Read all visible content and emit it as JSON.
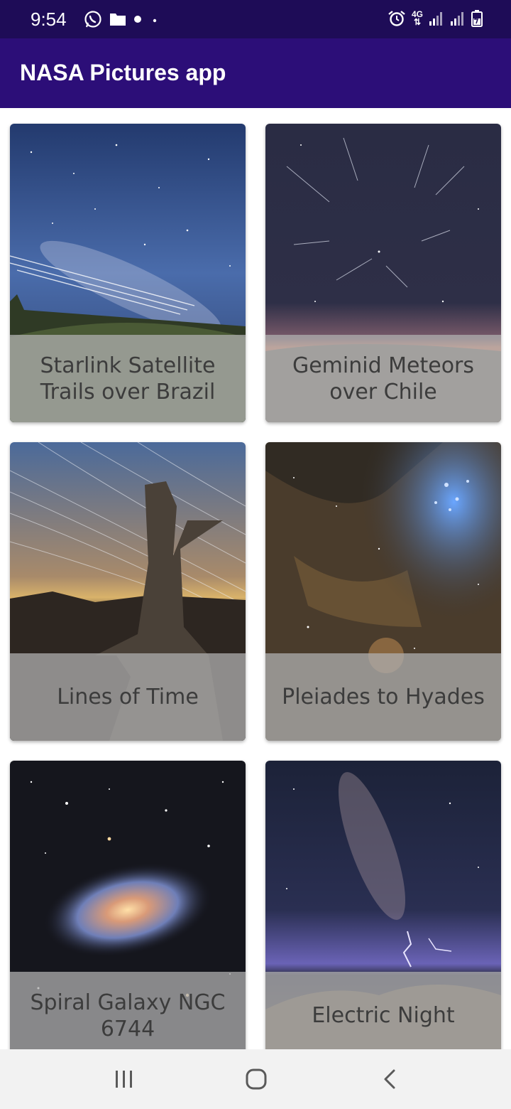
{
  "status_bar": {
    "time": "9:54",
    "network": "4G",
    "left_icons": [
      "whatsapp-icon",
      "folder-icon",
      "dot-icon"
    ],
    "right_icons": [
      "alarm-icon",
      "network-4g-icon",
      "signal-icon",
      "signal-icon",
      "battery-icon"
    ]
  },
  "app_bar": {
    "title": "NASA Pictures app",
    "color": "#2c0e78"
  },
  "pictures": [
    {
      "title": "Starlink Satellite Trails over Brazil"
    },
    {
      "title": "Geminid Meteors over Chile"
    },
    {
      "title": "Lines of Time"
    },
    {
      "title": "Pleiades to Hyades"
    },
    {
      "title": "Spiral Galaxy NGC 6744"
    },
    {
      "title": "Electric Night"
    }
  ],
  "nav_bar": {
    "icons": [
      "recent-apps-icon",
      "home-icon",
      "back-icon"
    ]
  }
}
